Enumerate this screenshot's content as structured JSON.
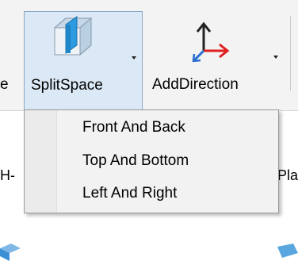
{
  "ribbon": {
    "left_partial_text": "e",
    "split_space": {
      "label": "SplitSpace",
      "icon": "split-space-cube-icon"
    },
    "add_direction": {
      "label": "AddDirection",
      "icon": "axes-direction-icon"
    }
  },
  "background": {
    "left_partial_text": "H-",
    "right_partial_text": "Pla"
  },
  "split_menu": {
    "items": [
      {
        "label": "Front And Back"
      },
      {
        "label": "Top And Bottom"
      },
      {
        "label": "Left And Right"
      }
    ]
  },
  "colors": {
    "ribbon_bg": "#f3f3f3",
    "hover_bg": "#dbe8f5",
    "hover_border": "#8aa9c9",
    "cube_fill": "#2e9be0",
    "arrow_red": "#e02020",
    "arrow_blue": "#2a6fd0"
  }
}
